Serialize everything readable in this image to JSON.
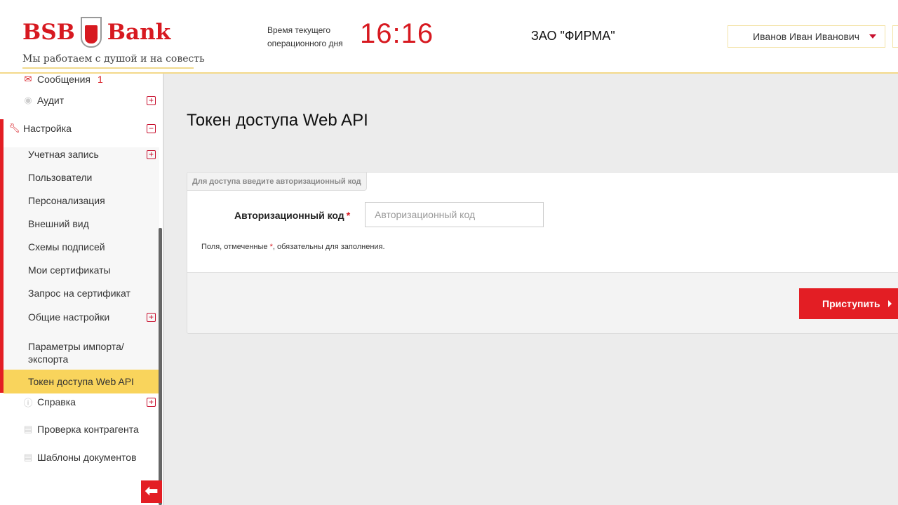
{
  "header": {
    "logo_text_left": "BSB",
    "logo_text_right": "Bank",
    "tagline": "Мы работаем с душой и на совесть",
    "time_label_1": "Время текущего",
    "time_label_2": "операционного дня",
    "time": "16:16",
    "company": "ЗАО \"ФИРМА\"",
    "user": "Иванов Иван Иванович"
  },
  "sidebar": {
    "messages": "Сообщения",
    "messages_count": "1",
    "audit": "Аудит",
    "settings": "Настройка",
    "sub": [
      "Учетная запись",
      "Пользователи",
      "Персонализация",
      "Внешний вид",
      "Схемы подписей",
      "Мои сертификаты",
      "Запрос на сертификат",
      "Общие настройки",
      "Параметры импорта/",
      "экспорта",
      "Токен доступа Web API"
    ],
    "help": "Справка",
    "check": "Проверка контрагента",
    "templates": "Шаблоны документов"
  },
  "main": {
    "title": "Токен доступа Web API",
    "legend": "Для доступа введите авторизационный код",
    "field_label": "Авторизационный код",
    "required_mark": "*",
    "placeholder": "Авторизационный код",
    "note_before": "Поля, отмеченные ",
    "note_after": ", обязательны для заполнения.",
    "submit": "Приступить"
  },
  "colors": {
    "accent": "#e31e24",
    "active": "#f9d45c"
  }
}
